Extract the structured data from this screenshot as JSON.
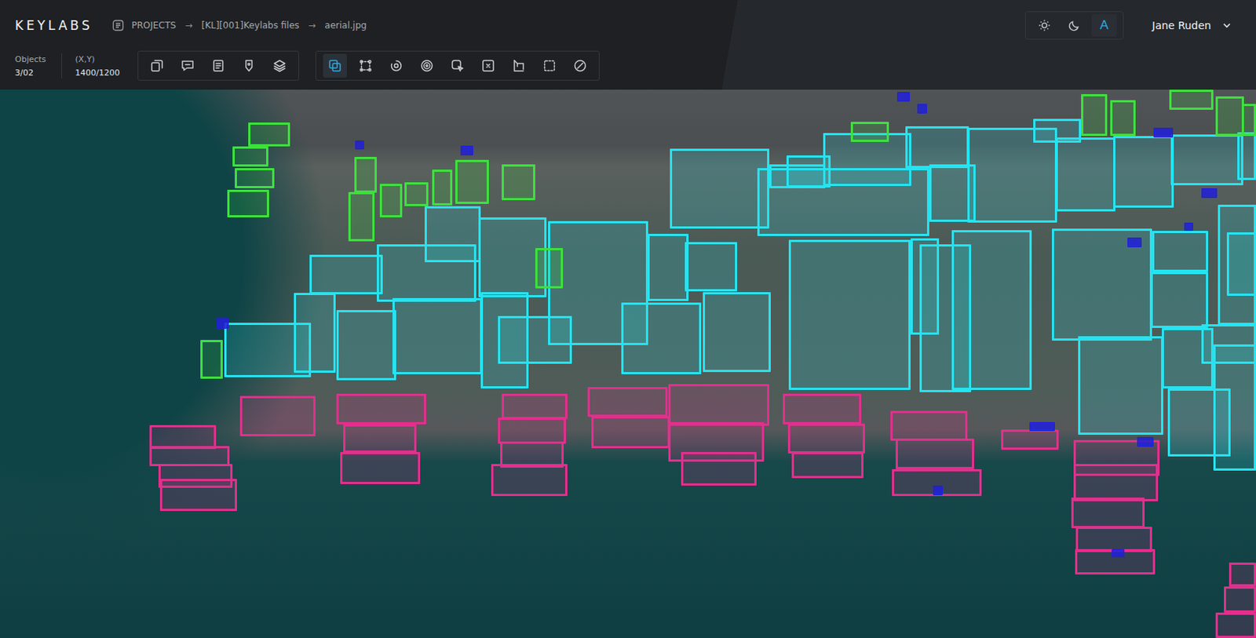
{
  "app": {
    "logo": "KEYLABS"
  },
  "breadcrumb": {
    "items": [
      "PROJECTS",
      "[KL][001]Keylabs files",
      "aerial.jpg"
    ],
    "separator": "→"
  },
  "stats": [
    {
      "label": "Objects",
      "value": "3/02"
    },
    {
      "label": "(X,Y)",
      "value": "1400/1200"
    }
  ],
  "toolbar_groups": [
    [
      {
        "kind": "crop",
        "selected": false
      },
      {
        "kind": "comment",
        "selected": false
      },
      {
        "kind": "list",
        "selected": false
      },
      {
        "kind": "tag",
        "selected": false
      },
      {
        "kind": "layers",
        "selected": false
      }
    ],
    [
      {
        "kind": "box",
        "selected": true
      },
      {
        "kind": "points",
        "selected": false
      },
      {
        "kind": "polygon",
        "selected": false
      },
      {
        "kind": "keypoints",
        "selected": false
      },
      {
        "kind": "brush",
        "selected": false
      },
      {
        "kind": "magic",
        "selected": false
      },
      {
        "kind": "cuboid",
        "selected": false
      },
      {
        "kind": "select",
        "selected": false
      },
      {
        "kind": "clear",
        "selected": false
      }
    ]
  ],
  "theme_switch": [
    {
      "kind": "sun",
      "label": "",
      "selected": false
    },
    {
      "kind": "moon",
      "label": "",
      "selected": false
    },
    {
      "kind": "auto",
      "label": "A",
      "selected": true
    }
  ],
  "user": {
    "name": "Jane Ruden"
  },
  "annotation_classes": [
    {
      "kind": "building",
      "color": "#27e3f0"
    },
    {
      "kind": "car",
      "color": "#3ee03e"
    },
    {
      "kind": "boat",
      "color": "#e0308c"
    },
    {
      "kind": "marker",
      "color": "#2020d8"
    }
  ]
}
